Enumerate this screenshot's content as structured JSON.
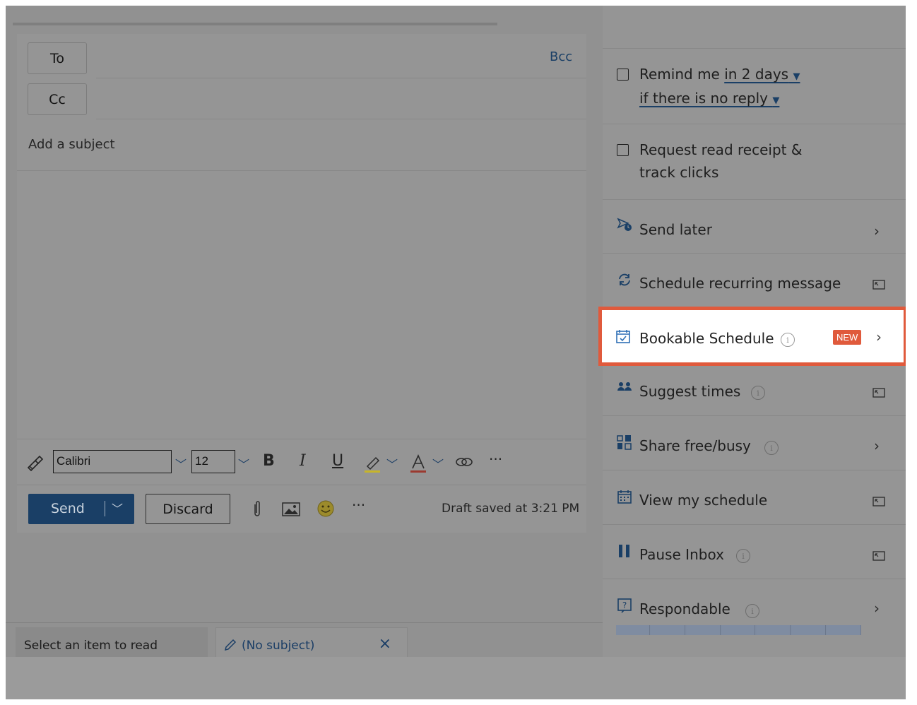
{
  "compose": {
    "to_label": "To",
    "cc_label": "Cc",
    "bcc_label": "Bcc",
    "subject_placeholder": "Add a subject",
    "font_name": "Calibri",
    "font_size": "12",
    "send_label": "Send",
    "discard_label": "Discard",
    "draft_status": "Draft saved at 3:21 PM",
    "more_glyph": "···"
  },
  "tabs": {
    "read_tab": "Select an item to read",
    "draft_tab": "(No subject)"
  },
  "panel": {
    "remind_prefix": "Remind me ",
    "remind_duration": "in 2 days",
    "remind_condition": "if there is no reply",
    "read_receipt_line1": "Request read receipt &",
    "read_receipt_line2": "track clicks",
    "send_later": "Send later",
    "schedule_recurring": "Schedule recurring message",
    "bookable_schedule": "Bookable Schedule",
    "new_badge": "NEW",
    "suggest_times": "Suggest times",
    "share_free_busy": "Share free/busy",
    "view_my_schedule": "View my schedule",
    "pause_inbox": "Pause Inbox",
    "respondable": "Respondable"
  },
  "colors": {
    "highlight_border": "#e05a3c",
    "accent_blue": "#1a3f66",
    "overlay_gray": "#959595"
  }
}
